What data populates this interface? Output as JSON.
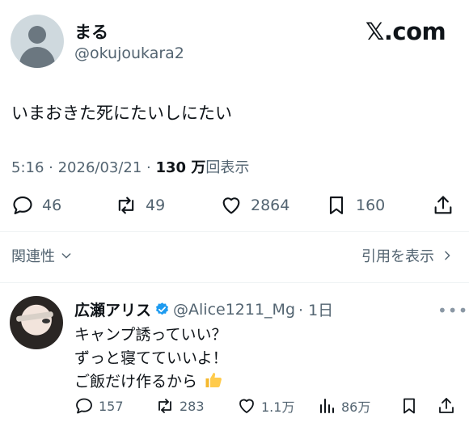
{
  "tweet": {
    "author_name": "まる",
    "author_handle": "@okujoukara2",
    "text": "いまおきた死にたいしにたい",
    "time": "5:16 · 2026/03/21 · ",
    "views_number": "130 万",
    "views_label": "回表示",
    "actions": {
      "replies": "46",
      "retweets": "49",
      "likes": "2864",
      "bookmarks": "160"
    }
  },
  "brand": "𝕏.com",
  "related_label": "関連性",
  "quotes_label": "引用を表示",
  "reply": {
    "author_name": "広瀬アリス",
    "author_handle": "@Alice1211_Mg",
    "age": "· 1日",
    "lines": [
      "キャンプ誘っていい？",
      "ずっと寝てていいよ！",
      "ご飯だけ作るから"
    ],
    "actions": {
      "replies": "157",
      "retweets": "283",
      "likes": "1.1万",
      "views": "86万"
    }
  },
  "colors": {
    "text": "#0f1419",
    "secondary": "#536471",
    "verified": "#1d9bf0"
  }
}
